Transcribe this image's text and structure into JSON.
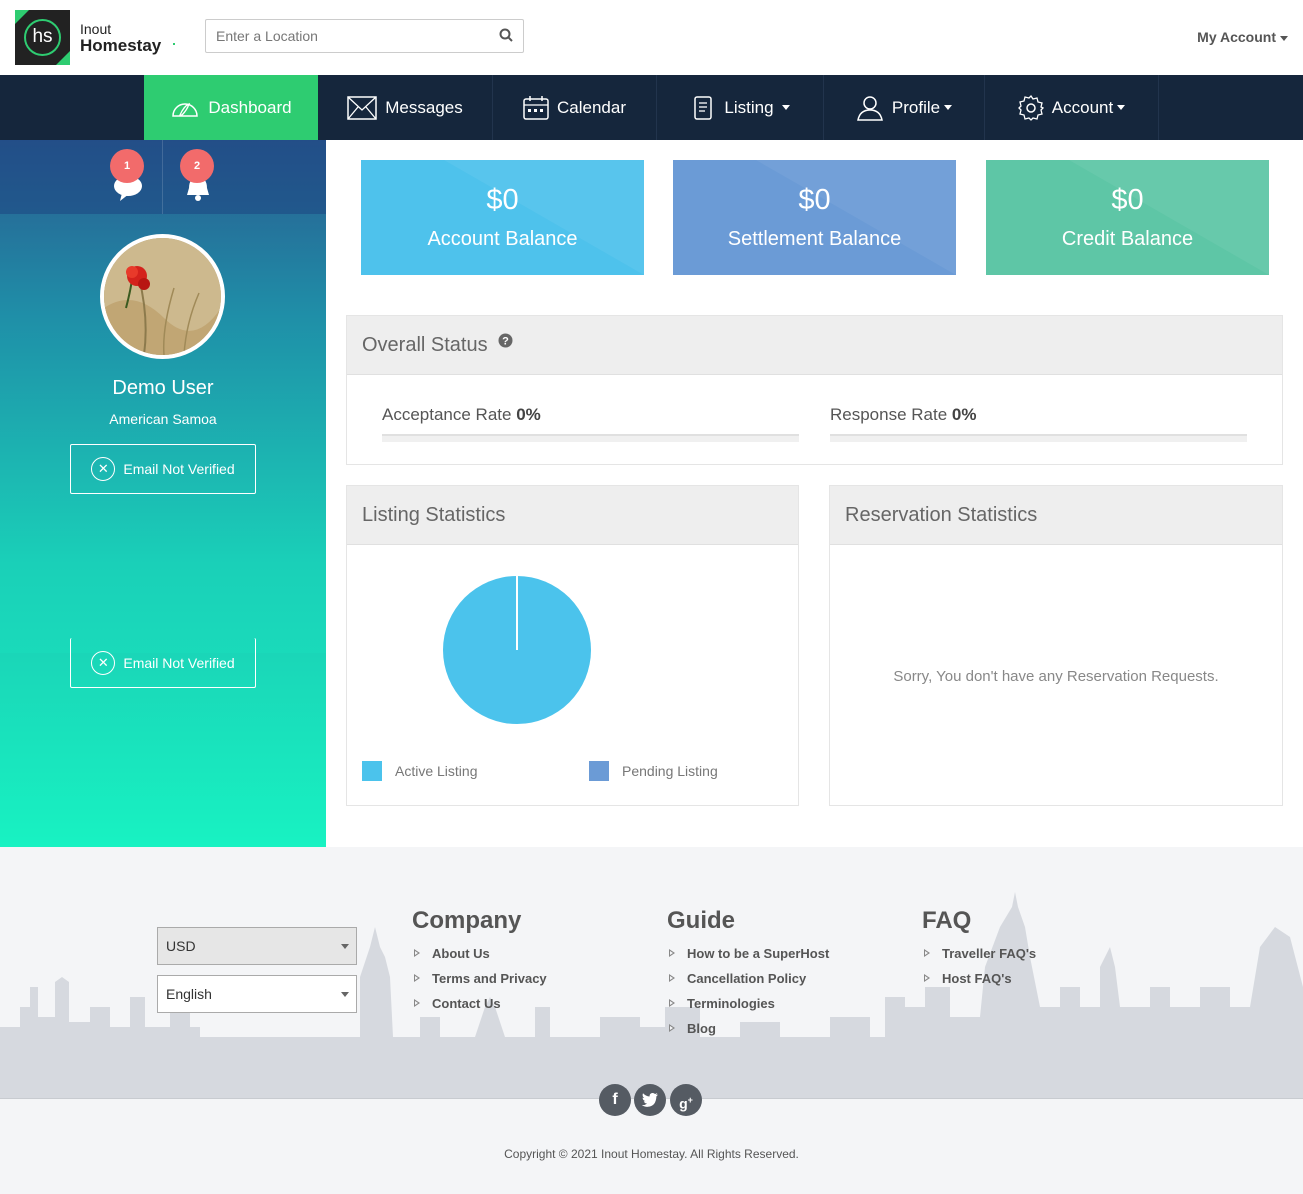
{
  "header": {
    "logo_small": "Inout",
    "logo_big": "Homestay",
    "logo_mark": "hs",
    "search_placeholder": "Enter a Location",
    "my_account": "My Account"
  },
  "nav": {
    "items": [
      {
        "label": "Dashboard",
        "icon": "dashboard-icon",
        "active": true
      },
      {
        "label": "Messages",
        "icon": "envelope-icon"
      },
      {
        "label": "Calendar",
        "icon": "calendar-icon"
      },
      {
        "label": "Listing",
        "icon": "document-icon",
        "dropdown": true
      },
      {
        "label": "Profile",
        "icon": "user-icon",
        "dropdown": true
      },
      {
        "label": "Account",
        "icon": "gear-icon",
        "dropdown": true
      }
    ]
  },
  "sidebar": {
    "message_count": "1",
    "notification_count": "2",
    "user_name": "Demo User",
    "user_location": "American Samoa",
    "verify_label": "Email Not Verified"
  },
  "balances": [
    {
      "amount": "$0",
      "label": "Account Balance",
      "color": "#4ec2ec"
    },
    {
      "amount": "$0",
      "label": "Settlement Balance",
      "color": "#6b9bd6"
    },
    {
      "amount": "$0",
      "label": "Credit Balance",
      "color": "#5ec6a6"
    }
  ],
  "overall_status": {
    "title": "Overall Status",
    "acceptance_label": "Acceptance Rate",
    "acceptance_value": "0%",
    "acceptance_fraction": 0,
    "response_label": "Response Rate",
    "response_value": "0%",
    "response_fraction": 0
  },
  "listing_stats": {
    "title": "Listing Statistics",
    "legend_active": "Active Listing",
    "legend_pending": "Pending Listing",
    "active_color": "#4bc3ec",
    "pending_color": "#6b9bd6"
  },
  "chart_data": {
    "type": "pie",
    "categories": [
      "Active Listing",
      "Pending Listing"
    ],
    "values": [
      100,
      0
    ],
    "colors": [
      "#4bc3ec",
      "#6b9bd6"
    ],
    "legend": "bottom"
  },
  "reservation_stats": {
    "title": "Reservation Statistics",
    "empty_message": "Sorry, You don't have any Reservation Requests."
  },
  "footer": {
    "currency": "USD",
    "language": "English",
    "company_title": "Company",
    "company_links": [
      "About Us",
      "Terms and Privacy",
      "Contact Us"
    ],
    "guide_title": "Guide",
    "guide_links": [
      "How to be a SuperHost",
      "Cancellation Policy",
      "Terminologies",
      "Blog"
    ],
    "faq_title": "FAQ",
    "faq_links": [
      "Traveller FAQ's",
      "Host FAQ's"
    ],
    "social": [
      "facebook-icon",
      "twitter-icon",
      "google-plus-icon"
    ],
    "copyright": "Copyright © 2021 Inout Homestay. All Rights Reserved."
  }
}
